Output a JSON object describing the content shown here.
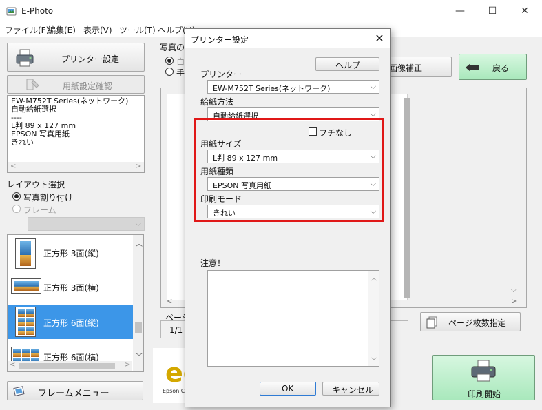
{
  "window": {
    "title": "E-Photo",
    "minimize": "—",
    "maximize": "☐",
    "close": "✕"
  },
  "menu": [
    "ファイル(F)",
    "編集(E)",
    "表示(V)",
    "ツール(T)",
    "ヘルプ(H)"
  ],
  "left_panel": {
    "printer_settings_button": "プリンター設定",
    "paper_check_button": "用紙設定確認",
    "info_lines": [
      "EW-M752T Series(ネットワーク)",
      "自動給紙選択",
      "----",
      "L判 89 x 127 mm",
      "EPSON 写真用紙",
      "きれい"
    ],
    "layout_title": "レイアウト選択",
    "layout_options": [
      "写真割り付け",
      "フレーム"
    ],
    "layout_items": [
      "正方形 3面(縦)",
      "正方形 3面(横)",
      "正方形 6面(縦)",
      "正方形 6面(横)"
    ],
    "frame_menu_button": "フレームメニュー"
  },
  "right_panel": {
    "group_title_partial": "写真の配",
    "radio_partial_1": "自動",
    "radio_partial_2": "手動",
    "image_correction_button": "画像補正",
    "back_button": "戻る",
    "page_label_partial": "ページ",
    "page_count": "1/1",
    "page_count_button": "ページ枚数指定",
    "print_start_button": "印刷開始",
    "epson_logo_partial": "Epson C"
  },
  "dialog": {
    "title": "プリンター設定",
    "close": "✕",
    "help_button": "ヘルプ",
    "printer_label": "プリンター",
    "printer_value": "EW-M752T Series(ネットワーク)",
    "feed_label": "給紙方法",
    "feed_value": "自動給紙選択",
    "borderless_label": "フチなし",
    "paper_size_label": "用紙サイズ",
    "paper_size_value": "L判 89 x 127 mm",
    "paper_type_label": "用紙種類",
    "paper_type_value": "EPSON 写真用紙",
    "print_mode_label": "印刷モード",
    "print_mode_value": "きれい",
    "notice_label": "注意！",
    "ok_button": "OK",
    "cancel_button": "キャンセル"
  },
  "colors": {
    "highlight_border": "#e01818",
    "selected_row": "#3c96e8",
    "green_button": "#b9efc9"
  }
}
